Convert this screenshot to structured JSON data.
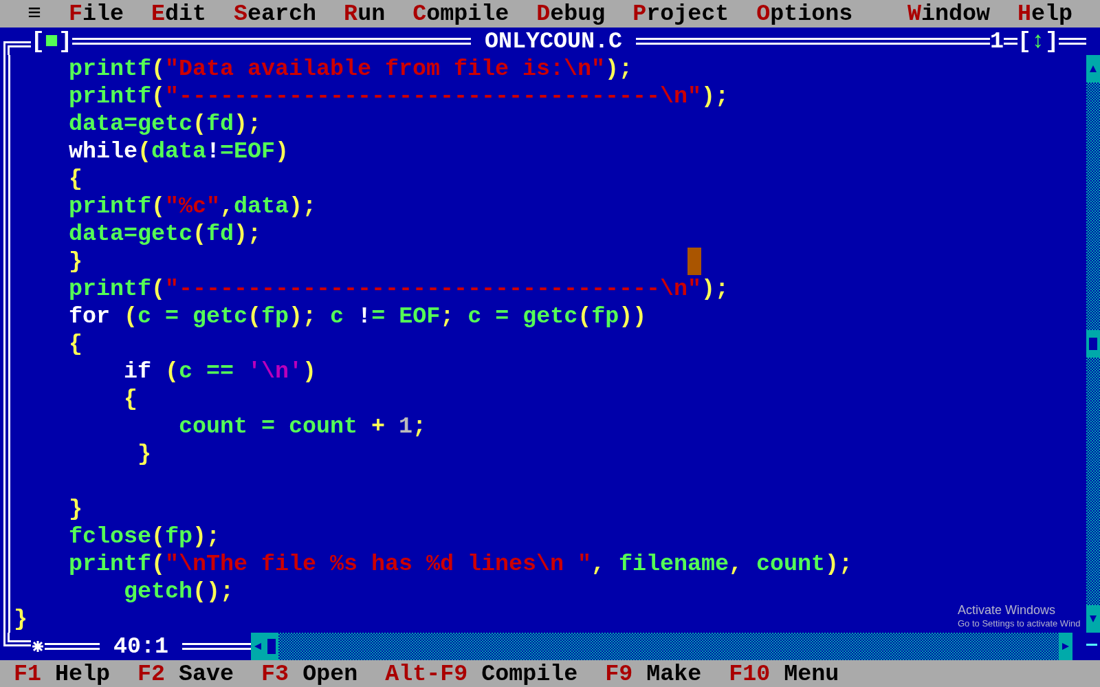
{
  "menu": {
    "system": "≡",
    "items": [
      "File",
      "Edit",
      "Search",
      "Run",
      "Compile",
      "Debug",
      "Project",
      "Options"
    ],
    "right_items": [
      "Window",
      "Help"
    ]
  },
  "window": {
    "close_box": "[■]",
    "title": "ONLYCOUN.C",
    "number": "1",
    "zoom_box": "[↕]",
    "position": "40:1"
  },
  "lines": [
    {
      "kind": "code",
      "tokens": [
        {
          "text": "    printf",
          "kind": "ident"
        },
        {
          "text": "(",
          "kind": "punct"
        },
        {
          "text": "\"Data available from file is:\\n\"",
          "kind": "string"
        },
        {
          "text": ");",
          "kind": "punct"
        }
      ]
    },
    {
      "kind": "code",
      "tokens": [
        {
          "text": "    printf",
          "kind": "ident"
        },
        {
          "text": "(",
          "kind": "punct"
        },
        {
          "text": "\"-----------------------------------\\n\"",
          "kind": "string"
        },
        {
          "text": ");",
          "kind": "punct"
        }
      ]
    },
    {
      "kind": "code",
      "tokens": [
        {
          "text": "    data=getc",
          "kind": "ident"
        },
        {
          "text": "(",
          "kind": "punct"
        },
        {
          "text": "fd",
          "kind": "ident"
        },
        {
          "text": ");",
          "kind": "punct"
        }
      ]
    },
    {
      "kind": "code",
      "tokens": [
        {
          "text": "    while",
          "kind": "keyword"
        },
        {
          "text": "(",
          "kind": "punct"
        },
        {
          "text": "data",
          "kind": "ident"
        },
        {
          "text": "!",
          "kind": "keyword"
        },
        {
          "text": "=EOF",
          "kind": "ident"
        },
        {
          "text": ")",
          "kind": "punct"
        }
      ]
    },
    {
      "kind": "code",
      "tokens": [
        {
          "text": "    {",
          "kind": "punct"
        }
      ]
    },
    {
      "kind": "code",
      "tokens": [
        {
          "text": "    printf",
          "kind": "ident"
        },
        {
          "text": "(",
          "kind": "punct"
        },
        {
          "text": "\"%c\"",
          "kind": "string"
        },
        {
          "text": ",",
          "kind": "punct"
        },
        {
          "text": "data",
          "kind": "ident"
        },
        {
          "text": ");",
          "kind": "punct"
        }
      ]
    },
    {
      "kind": "code",
      "tokens": [
        {
          "text": "    data=getc",
          "kind": "ident"
        },
        {
          "text": "(",
          "kind": "punct"
        },
        {
          "text": "fd",
          "kind": "ident"
        },
        {
          "text": ");",
          "kind": "punct"
        }
      ]
    },
    {
      "kind": "code",
      "tokens": [
        {
          "text": "    }",
          "kind": "punct"
        }
      ]
    },
    {
      "kind": "code",
      "tokens": [
        {
          "text": "    printf",
          "kind": "ident"
        },
        {
          "text": "(",
          "kind": "punct"
        },
        {
          "text": "\"-----------------------------------\\n\"",
          "kind": "string"
        },
        {
          "text": ");",
          "kind": "punct"
        }
      ]
    },
    {
      "kind": "code",
      "tokens": [
        {
          "text": "    for",
          "kind": "keyword"
        },
        {
          "text": " (",
          "kind": "punct"
        },
        {
          "text": "c = getc",
          "kind": "ident"
        },
        {
          "text": "(",
          "kind": "punct"
        },
        {
          "text": "fp",
          "kind": "ident"
        },
        {
          "text": ");",
          "kind": "punct"
        },
        {
          "text": " c ",
          "kind": "ident"
        },
        {
          "text": "!",
          "kind": "keyword"
        },
        {
          "text": "= EOF",
          "kind": "ident"
        },
        {
          "text": ";",
          "kind": "punct"
        },
        {
          "text": " c = getc",
          "kind": "ident"
        },
        {
          "text": "(",
          "kind": "punct"
        },
        {
          "text": "fp",
          "kind": "ident"
        },
        {
          "text": "))",
          "kind": "punct"
        }
      ]
    },
    {
      "kind": "code",
      "tokens": [
        {
          "text": "    {",
          "kind": "punct"
        }
      ]
    },
    {
      "kind": "code",
      "tokens": [
        {
          "text": "        if",
          "kind": "keyword"
        },
        {
          "text": " (",
          "kind": "punct"
        },
        {
          "text": "c == ",
          "kind": "ident"
        },
        {
          "text": "'\\n'",
          "kind": "char"
        },
        {
          "text": ")",
          "kind": "punct"
        }
      ]
    },
    {
      "kind": "code",
      "tokens": [
        {
          "text": "        {",
          "kind": "punct"
        }
      ]
    },
    {
      "kind": "code",
      "tokens": [
        {
          "text": "            count = count ",
          "kind": "ident"
        },
        {
          "text": "+ ",
          "kind": "punct"
        },
        {
          "text": "1",
          "kind": "number"
        },
        {
          "text": ";",
          "kind": "punct"
        }
      ]
    },
    {
      "kind": "code",
      "tokens": [
        {
          "text": "         }",
          "kind": "punct"
        }
      ]
    },
    {
      "kind": "blank"
    },
    {
      "kind": "code",
      "tokens": [
        {
          "text": "    }",
          "kind": "punct"
        }
      ]
    },
    {
      "kind": "code",
      "tokens": [
        {
          "text": "    fclose",
          "kind": "ident"
        },
        {
          "text": "(",
          "kind": "punct"
        },
        {
          "text": "fp",
          "kind": "ident"
        },
        {
          "text": ");",
          "kind": "punct"
        }
      ]
    },
    {
      "kind": "code",
      "tokens": [
        {
          "text": "    printf",
          "kind": "ident"
        },
        {
          "text": "(",
          "kind": "punct"
        },
        {
          "text": "\"\\nThe file %s has %d lines\\n \"",
          "kind": "string"
        },
        {
          "text": ",",
          "kind": "punct"
        },
        {
          "text": " filename",
          "kind": "ident"
        },
        {
          "text": ",",
          "kind": "punct"
        },
        {
          "text": " count",
          "kind": "ident"
        },
        {
          "text": ");",
          "kind": "punct"
        }
      ]
    },
    {
      "kind": "code",
      "tokens": [
        {
          "text": "        getch",
          "kind": "ident"
        },
        {
          "text": "();",
          "kind": "punct"
        }
      ]
    },
    {
      "kind": "code",
      "tokens": [
        {
          "text": "}",
          "kind": "punct"
        }
      ]
    }
  ],
  "function_keys": [
    {
      "key": "F1",
      "label": "Help"
    },
    {
      "key": "F2",
      "label": "Save"
    },
    {
      "key": "F3",
      "label": "Open"
    },
    {
      "key": "Alt-F9",
      "label": "Compile"
    },
    {
      "key": "F9",
      "label": "Make"
    },
    {
      "key": "F10",
      "label": "Menu"
    }
  ],
  "os_notice": {
    "title": "Activate Windows",
    "subtitle": "Go to Settings to activate Wind"
  }
}
